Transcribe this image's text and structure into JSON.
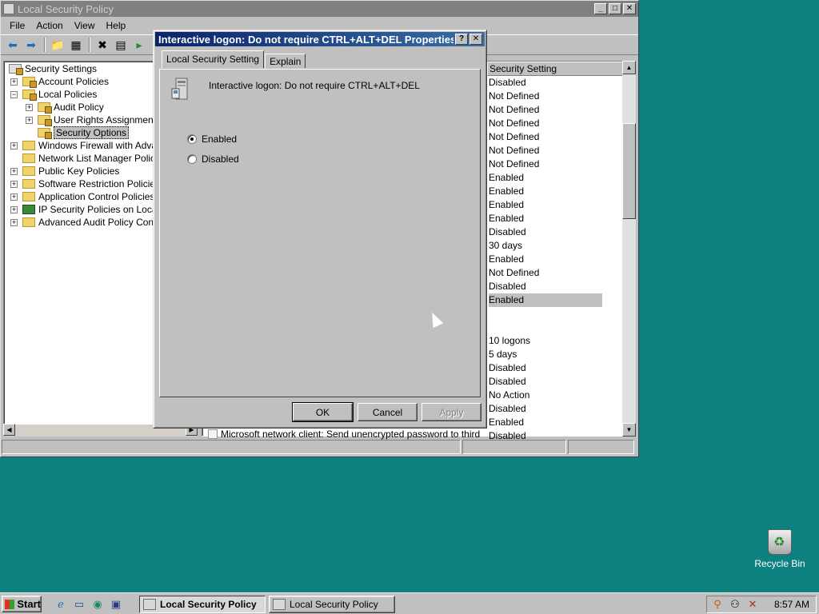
{
  "main_window": {
    "title": "Local Security Policy",
    "controls": {
      "minimize": "_",
      "maximize": "□",
      "close": "✕"
    },
    "menu": [
      "File",
      "Action",
      "View",
      "Help"
    ],
    "toolbar_icons": [
      "back-icon",
      "forward-icon",
      "up-icon",
      "show-hide-tree-icon",
      "delete-icon",
      "properties-icon",
      "export-icon"
    ]
  },
  "tree": {
    "items": [
      {
        "label": "Security Settings",
        "expander": ""
      },
      {
        "label": "Account Policies",
        "expander": "+"
      },
      {
        "label": "Local Policies",
        "expander": "−"
      },
      {
        "label": "Audit Policy",
        "expander": "+"
      },
      {
        "label": "User Rights Assignment",
        "expander": "+"
      },
      {
        "label": "Security Options",
        "expander": "",
        "selected": true
      },
      {
        "label": "Windows Firewall with Advance",
        "expander": "+"
      },
      {
        "label": "Network List Manager Policies",
        "expander": ""
      },
      {
        "label": "Public Key Policies",
        "expander": "+"
      },
      {
        "label": "Software Restriction Policies",
        "expander": "+"
      },
      {
        "label": "Application Control Policies",
        "expander": "+"
      },
      {
        "label": "IP Security Policies on Local C",
        "expander": "+"
      },
      {
        "label": "Advanced Audit Policy Config",
        "expander": "+"
      }
    ]
  },
  "list": {
    "column_header": "Security Setting",
    "values": [
      "Disabled",
      "Not Defined",
      "Not Defined",
      "Not Defined",
      "Not Defined",
      "Not Defined",
      "Not Defined",
      "Enabled",
      "Enabled",
      "Enabled",
      "Enabled",
      "Disabled",
      "30 days",
      "Enabled",
      "Not Defined",
      "Disabled",
      "Enabled",
      "",
      "",
      "10 logons",
      "5 days",
      "Disabled",
      "Disabled",
      "No Action",
      "Disabled",
      "Enabled",
      "Disabled"
    ],
    "highlighted_index": 16,
    "partial_row_text": "Microsoft network client: Send unencrypted password to third-party"
  },
  "dialog": {
    "title": "Interactive logon: Do not require CTRL+ALT+DEL Properties",
    "help_btn": "?",
    "close_btn": "✕",
    "tabs": [
      "Local Security Setting",
      "Explain"
    ],
    "policy_name": "Interactive logon: Do not require CTRL+ALT+DEL",
    "options": [
      {
        "label": "Enabled",
        "checked": true
      },
      {
        "label": "Disabled",
        "checked": false
      }
    ],
    "buttons": {
      "ok": "OK",
      "cancel": "Cancel",
      "apply": "Apply"
    }
  },
  "desktop": {
    "recycle_bin_label": "Recycle Bin"
  },
  "taskbar": {
    "start_label": "Start",
    "tasks": [
      "Local Security Policy",
      "Local Security Policy"
    ],
    "clock": "8:57 AM"
  }
}
